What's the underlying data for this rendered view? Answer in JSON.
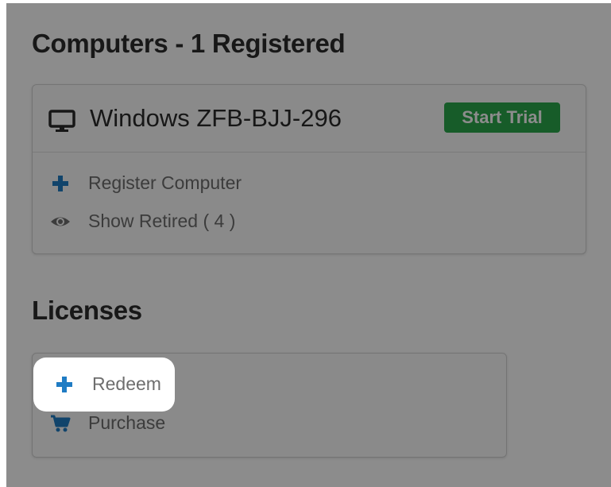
{
  "computers": {
    "title": "Computers - 1 Registered",
    "items": [
      {
        "name": "Windows ZFB-BJJ-296",
        "action_label": "Start Trial",
        "icon": "monitor-icon"
      }
    ],
    "actions": {
      "register_label": "Register Computer",
      "show_retired_label": "Show Retired ( 4 )"
    }
  },
  "licenses": {
    "title": "Licenses",
    "actions": {
      "redeem_label": "Redeem",
      "purchase_label": "Purchase"
    }
  },
  "colors": {
    "accent_blue": "#1f7cc4",
    "start_trial_green": "#2aa84b",
    "text_dark": "#2b2b2b",
    "text_muted": "#6e6e6e"
  }
}
